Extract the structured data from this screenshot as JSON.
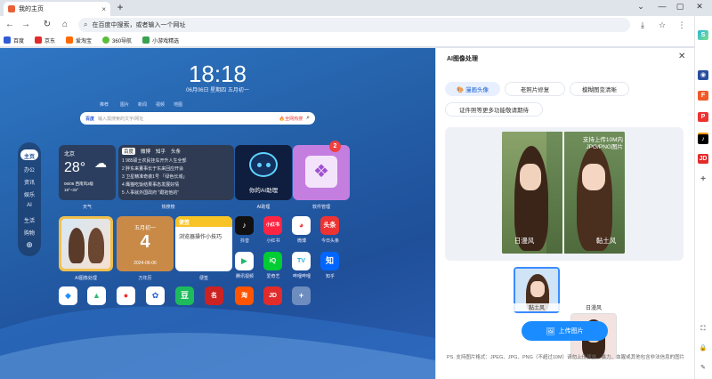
{
  "browser": {
    "tab_title": "我的主页",
    "address_placeholder": "在百度中搜索，或者输入一个网址",
    "bookmarks": [
      {
        "label": "百度",
        "color": "#2f5cd6"
      },
      {
        "label": "京东",
        "color": "#e22b2b"
      },
      {
        "label": "爱淘宝",
        "color": "#ff6a00"
      },
      {
        "label": "360导航",
        "color": "#5bbd3a"
      },
      {
        "label": "小游戏精选",
        "color": "#3aa24f"
      }
    ]
  },
  "homepage": {
    "time": "18:18",
    "date": "06月06日 星期四 五月初一",
    "news_tabs": [
      "推荐",
      "图片",
      "新闻",
      "视频",
      "地图"
    ],
    "search_placeholder": "输入需搜索的文字/网址",
    "hot_search": "🔥全网热搜",
    "nav": [
      "主页",
      "办公",
      "资讯",
      "娱乐",
      "AI",
      "生活",
      "购物"
    ],
    "weather": {
      "city": "北京",
      "temp": "28°",
      "detail": "06/06 西南风3级",
      "range": "18°~33°",
      "label": "天气"
    },
    "hot": {
      "tabs": [
        "百度",
        "微博",
        "知乎",
        "头条"
      ],
      "items": [
        "1 985硕士农民挂车开升人生全部",
        "2 胖东来董事长于东来回应开会",
        "3 卫星精准奇袭1号 「绿色长城」",
        "4 鹰猫吃饭结果事态发展好情",
        "5 人事就外国政府 \"跟拓他的\""
      ],
      "label": "热搜榜"
    },
    "ai_assistant": {
      "title": "你的AI助理",
      "label": "AI助理"
    },
    "software": {
      "label": "软件管理",
      "badge": "2"
    },
    "ai_image": {
      "label": "AI图像处理"
    },
    "calendar": {
      "label": "万年历",
      "top": "五月初一",
      "big": "4",
      "date": "2024-06-06"
    },
    "note": {
      "title": "便签",
      "body": "浏览器操作小技巧",
      "label": "便签"
    },
    "apps": [
      {
        "label": "抖音",
        "color": "#111",
        "glyph": "♪"
      },
      {
        "label": "小红书",
        "color": "#ff2442",
        "glyph": "小红书"
      },
      {
        "label": "微博",
        "color": "#fff",
        "glyph": "◕"
      },
      {
        "label": "今日头条",
        "color": "#e33",
        "glyph": "头条"
      },
      {
        "label": "腾讯视频",
        "color": "#fff",
        "glyph": "▶"
      },
      {
        "label": "爱奇艺",
        "color": "#0c3",
        "glyph": "iQ"
      },
      {
        "label": "哔哩哔哩",
        "color": "#fff",
        "glyph": "TV"
      },
      {
        "label": "知乎",
        "color": "#0066ff",
        "glyph": "知"
      }
    ]
  },
  "panel": {
    "title": "AI图像处理",
    "chips": [
      "🎨 漫画头像",
      "老照片修复",
      "模糊图变清晰",
      "证件照等更多功能敬请期待"
    ],
    "preview_left": "日漫风",
    "preview_right": "黏土风",
    "preview_overlay": "支持上传10M内JPG/PNG图片",
    "thumbs": [
      "黏土风",
      "日漫风"
    ],
    "upload": "上传图片",
    "note": "PS. 支持图片格式：JPEG、JPG、PNG（不超过10M）请勿上传裸露、暴力、血腥或其他包含非法信息的图片"
  }
}
